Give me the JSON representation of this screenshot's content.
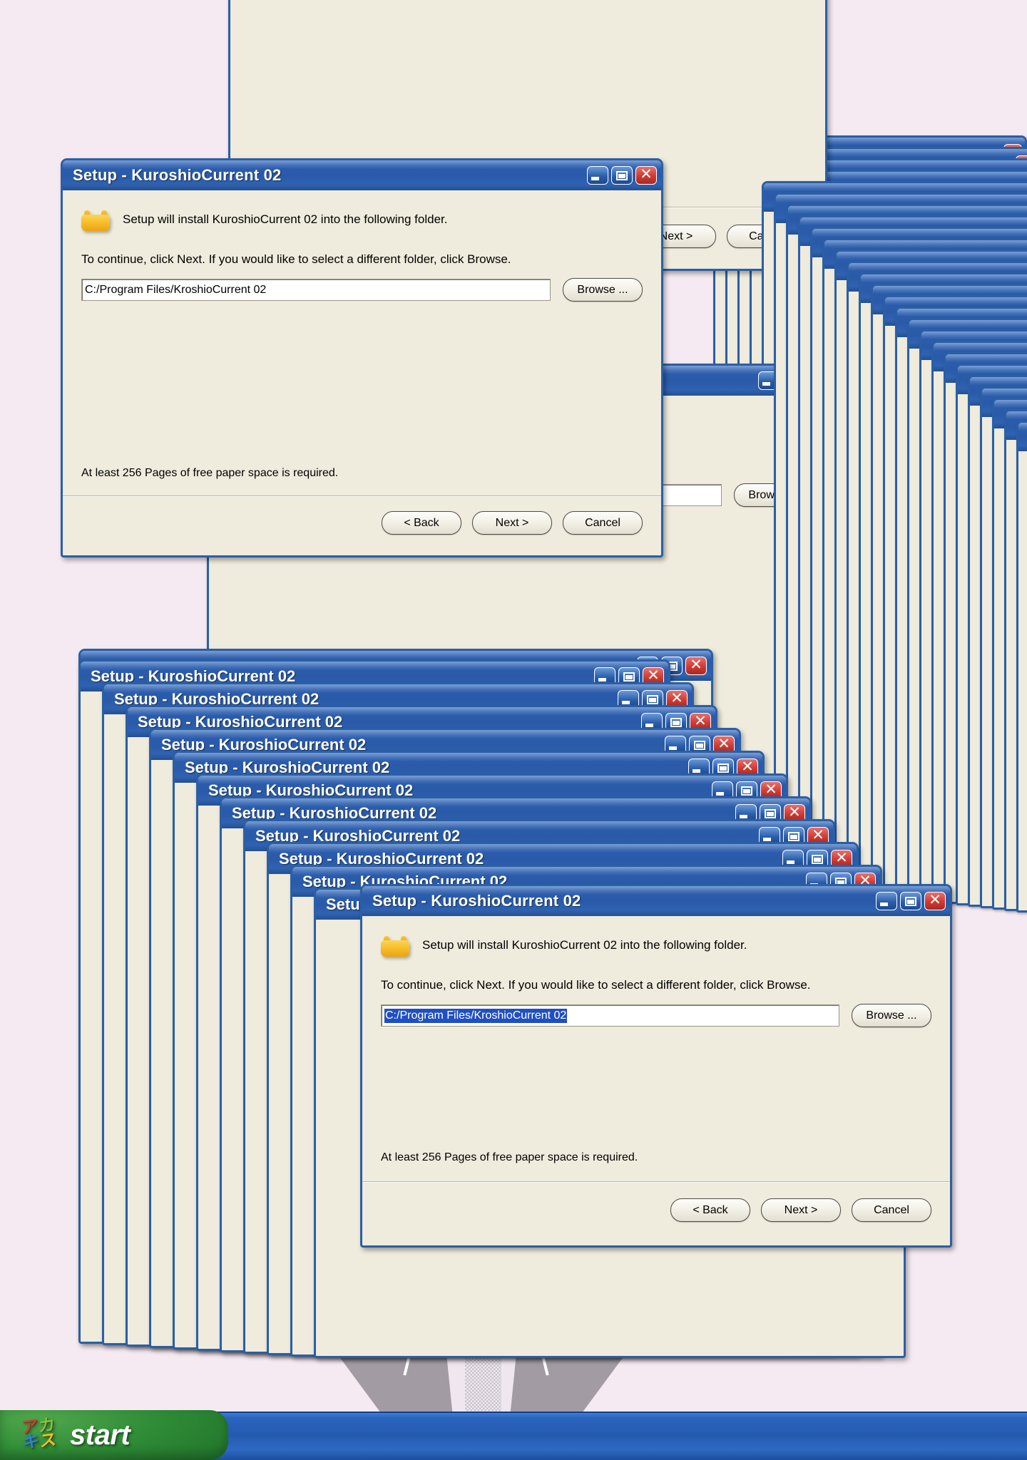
{
  "desktop": {
    "background_color": "#f6eaf2",
    "accent_blue": "#2a5fa5",
    "dialog_face": "#efebdd",
    "selection_blue": "#1f4fc4"
  },
  "dialog": {
    "title": "Setup - KuroshioCurrent 02",
    "message": "Setup will install KuroshioCurrent 02 into the following folder.",
    "instruction": "To continue, click Next. If you would like to select a different folder, click Browse.",
    "path_value": "C:/Program Files/KroshioCurrent 02",
    "browse_label": "Browse ...",
    "space_note": "At least 256 Pages of free paper space is required.",
    "back_label": "< Back",
    "next_label": "Next >",
    "cancel_label": "Cancel",
    "icons": {
      "app": "folder-icon",
      "minimize": "minimize-icon",
      "maximize": "maximize-icon",
      "close": "close-icon"
    }
  },
  "clipped": {
    "browse_word": "Browse.",
    "next_partial": "xt >"
  },
  "taskbar": {
    "start_label": "start",
    "logo_glyphs": [
      "ア",
      "カ",
      "キ",
      "ス"
    ]
  },
  "stack": {
    "title_repeat_count": 11,
    "sliver_count": 26
  }
}
